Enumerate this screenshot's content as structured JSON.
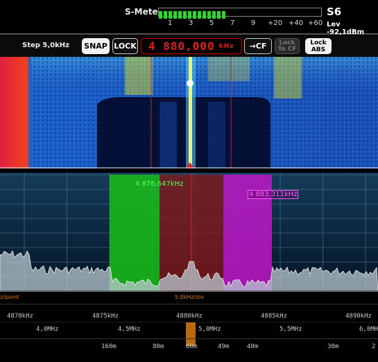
{
  "smeter": {
    "label": "S-Meter",
    "scale": [
      "1",
      "3",
      "5",
      "7",
      "9",
      "+20",
      "+40",
      "+60"
    ],
    "s_value": "S6",
    "level": "Lev -92,1dBm",
    "fill_fraction": 0.42
  },
  "controls": {
    "step": "Step 5,0kHz",
    "snap": "SNAP",
    "lock": "LOCK",
    "frequency": "4 880,000",
    "freq_unit": "kHz",
    "to_cf": "→CF",
    "lock_tocf_line1": "Lock",
    "lock_tocf_line2": "To CF",
    "lock_abs_line1": "Lock",
    "lock_abs_line2": "ABS"
  },
  "spectrum": {
    "green_marker": "4 876,647kHz",
    "magenta_marker": "4 883,311kHz",
    "left_label": "z/point",
    "div_label": "5,0kHz/div"
  },
  "scales": {
    "khz": [
      "4870kHz",
      "4875kHz",
      "4880kHz",
      "4885kHz",
      "4890kHz"
    ],
    "mhz": [
      "4,0MHz",
      "4,5MHz",
      "5,0MHz",
      "5,5MHz",
      "6,0MHz"
    ],
    "bands": [
      "160m",
      "80m",
      "60m",
      "49m",
      "40m",
      "30m",
      "2"
    ]
  },
  "colors": {
    "accent_red": "#e02020",
    "green_band": "#18c018",
    "magenta_band": "#c018c8",
    "meter_green": "#2ad82a"
  }
}
